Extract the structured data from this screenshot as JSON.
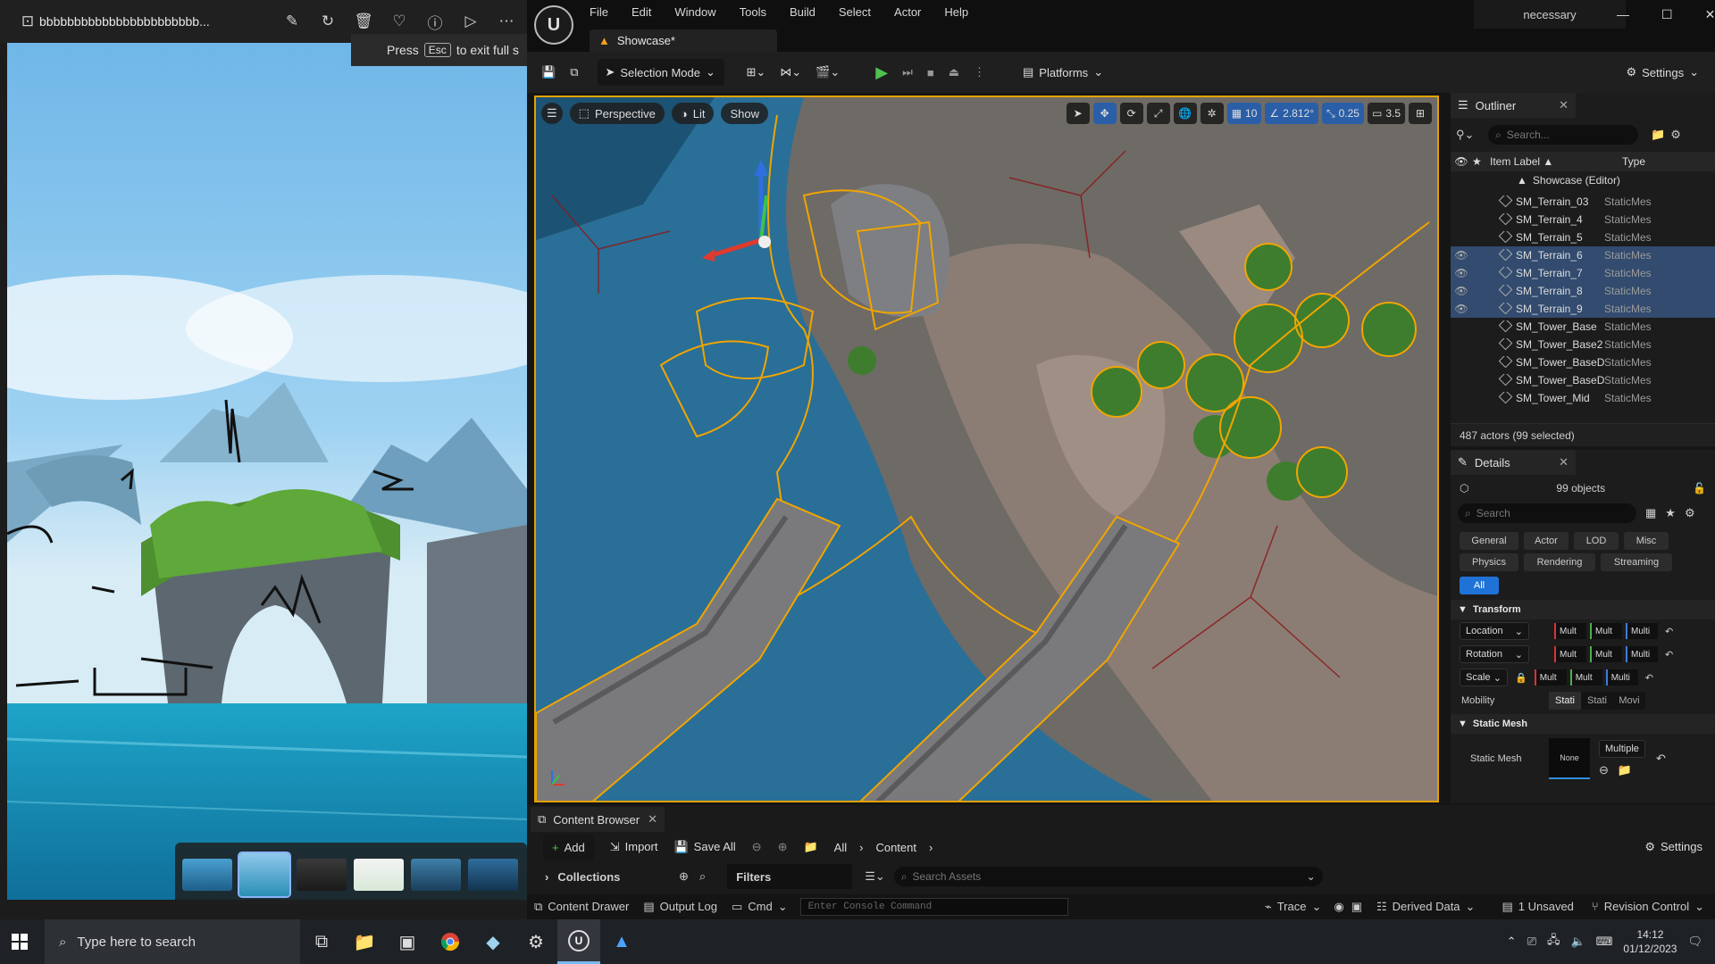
{
  "photos": {
    "title": "bbbbbbbbbbbbbbbbbbbbbbb...",
    "esc_prefix": "Press",
    "esc_key": "Esc",
    "esc_suffix": "to exit full s"
  },
  "ue": {
    "menu": [
      "File",
      "Edit",
      "Window",
      "Tools",
      "Build",
      "Select",
      "Actor",
      "Help"
    ],
    "tab": "Showcase*",
    "project_name": "necessary",
    "toolbar": {
      "selection_mode": "Selection Mode",
      "platforms": "Platforms",
      "settings": "Settings"
    },
    "viewport": {
      "perspective": "Perspective",
      "lit": "Lit",
      "show": "Show",
      "grid_snap": "10",
      "rotation_snap": "2.812°",
      "scale_snap": "0.25",
      "camera_speed": "3.5"
    },
    "outliner": {
      "title": "Outliner",
      "search_placeholder": "Search...",
      "col_label": "Item Label ▲",
      "col_type": "Type",
      "root": "Showcase (Editor)",
      "rows": [
        {
          "name": "SM_Terrain_03",
          "type": "StaticMes",
          "selected": false
        },
        {
          "name": "SM_Terrain_4",
          "type": "StaticMes",
          "selected": false
        },
        {
          "name": "SM_Terrain_5",
          "type": "StaticMes",
          "selected": false
        },
        {
          "name": "SM_Terrain_6",
          "type": "StaticMes",
          "selected": true
        },
        {
          "name": "SM_Terrain_7",
          "type": "StaticMes",
          "selected": true
        },
        {
          "name": "SM_Terrain_8",
          "type": "StaticMes",
          "selected": true
        },
        {
          "name": "SM_Terrain_9",
          "type": "StaticMes",
          "selected": true
        },
        {
          "name": "SM_Tower_Base",
          "type": "StaticMes",
          "selected": false
        },
        {
          "name": "SM_Tower_Base2",
          "type": "StaticMes",
          "selected": false
        },
        {
          "name": "SM_Tower_BaseD",
          "type": "StaticMes",
          "selected": false
        },
        {
          "name": "SM_Tower_BaseD",
          "type": "StaticMes",
          "selected": false
        },
        {
          "name": "SM_Tower_Mid",
          "type": "StaticMes",
          "selected": false
        }
      ],
      "footer": "487 actors (99 selected)"
    },
    "details": {
      "title": "Details",
      "objects": "99 objects",
      "search_placeholder": "Search",
      "chips": [
        "General",
        "Actor",
        "LOD",
        "Misc",
        "Physics",
        "Rendering",
        "Streaming",
        "All"
      ],
      "transform": "Transform",
      "location": "Location",
      "rotation": "Rotation",
      "scale": "Scale",
      "mult_short": "Mult",
      "multi": "Multi",
      "mobility": "Mobility",
      "mobility_opts": [
        "Stati",
        "Stati",
        "Movi"
      ],
      "static_mesh_section": "Static Mesh",
      "static_mesh_label": "Static Mesh",
      "none": "None",
      "multiple": "Multiple"
    },
    "content_browser": {
      "tab": "Content Browser",
      "add": "Add",
      "import": "Import",
      "save_all": "Save All",
      "crumb_all": "All",
      "crumb_content": "Content",
      "settings": "Settings",
      "collections": "Collections",
      "filters": "Filters",
      "search_placeholder": "Search Assets"
    },
    "status": {
      "content_drawer": "Content Drawer",
      "output_log": "Output Log",
      "cmd": "Cmd",
      "console_placeholder": "Enter Console Command",
      "trace": "Trace",
      "derived_data": "Derived Data",
      "unsaved": "1 Unsaved",
      "revision": "Revision Control"
    }
  },
  "taskbar": {
    "search_placeholder": "Type here to search",
    "time": "14:12",
    "date": "01/12/2023"
  }
}
